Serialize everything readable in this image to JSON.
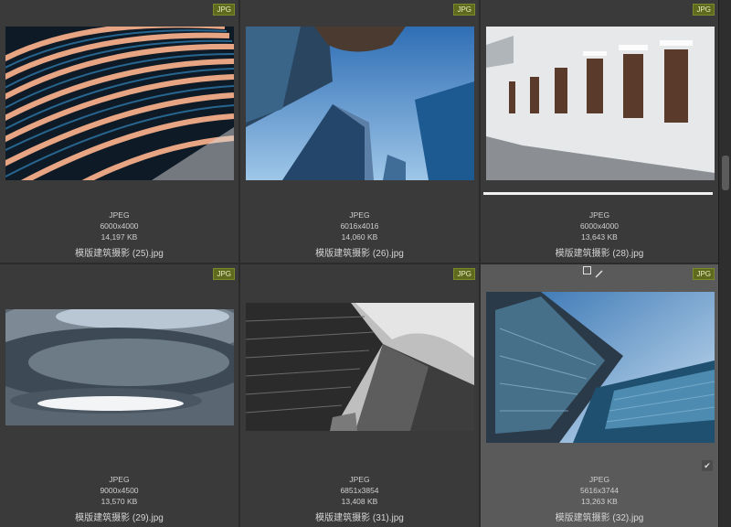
{
  "badge_label": "JPG",
  "tiles": [
    {
      "format": "JPEG",
      "dimensions": "6000x4000",
      "size": "14,197 KB",
      "filename": "模版建筑摄影 (25).jpg"
    },
    {
      "format": "JPEG",
      "dimensions": "6016x4016",
      "size": "14,060 KB",
      "filename": "模版建筑摄影 (26).jpg"
    },
    {
      "format": "JPEG",
      "dimensions": "6000x4000",
      "size": "13,643 KB",
      "filename": "模版建筑摄影 (28).jpg"
    },
    {
      "format": "JPEG",
      "dimensions": "9000x4500",
      "size": "13,570 KB",
      "filename": "模版建筑摄影 (29).jpg"
    },
    {
      "format": "JPEG",
      "dimensions": "6851x3854",
      "size": "13,408 KB",
      "filename": "模版建筑摄影 (31).jpg"
    },
    {
      "format": "JPEG",
      "dimensions": "5616x3744",
      "size": "13,263 KB",
      "filename": "模版建筑摄影 (32).jpg"
    }
  ],
  "selected_tile_index": 5,
  "colors": {
    "badge": "#5f6a1e",
    "tile_bg": "#3a3a3a",
    "selected_bg": "#5a5a5a"
  }
}
